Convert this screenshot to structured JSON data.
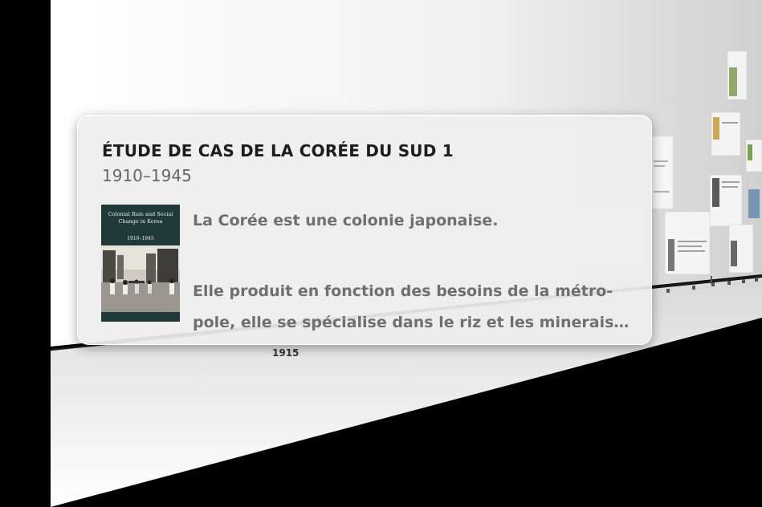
{
  "timeline": {
    "year_tick_label": "1915"
  },
  "popover": {
    "title": "ÉTUDE DE CAS DE LA CORÉE DU SUD 1",
    "dates": "1910–1945",
    "line1": "La Corée est une colonie japonaise.",
    "line2a": "Elle produit en fonction des besoins de la métro-",
    "line2b": "pole, elle se spécialise dans le riz et les minerais…",
    "book_cover": {
      "title": "Colonial Rule and Social Change in Korea",
      "dates": "1910–1945"
    }
  },
  "colors": {
    "background": "#000000",
    "wall_light": "#f6f6f6",
    "popover_bg": "#eeeeee",
    "cover_dark": "#1f3a38"
  }
}
